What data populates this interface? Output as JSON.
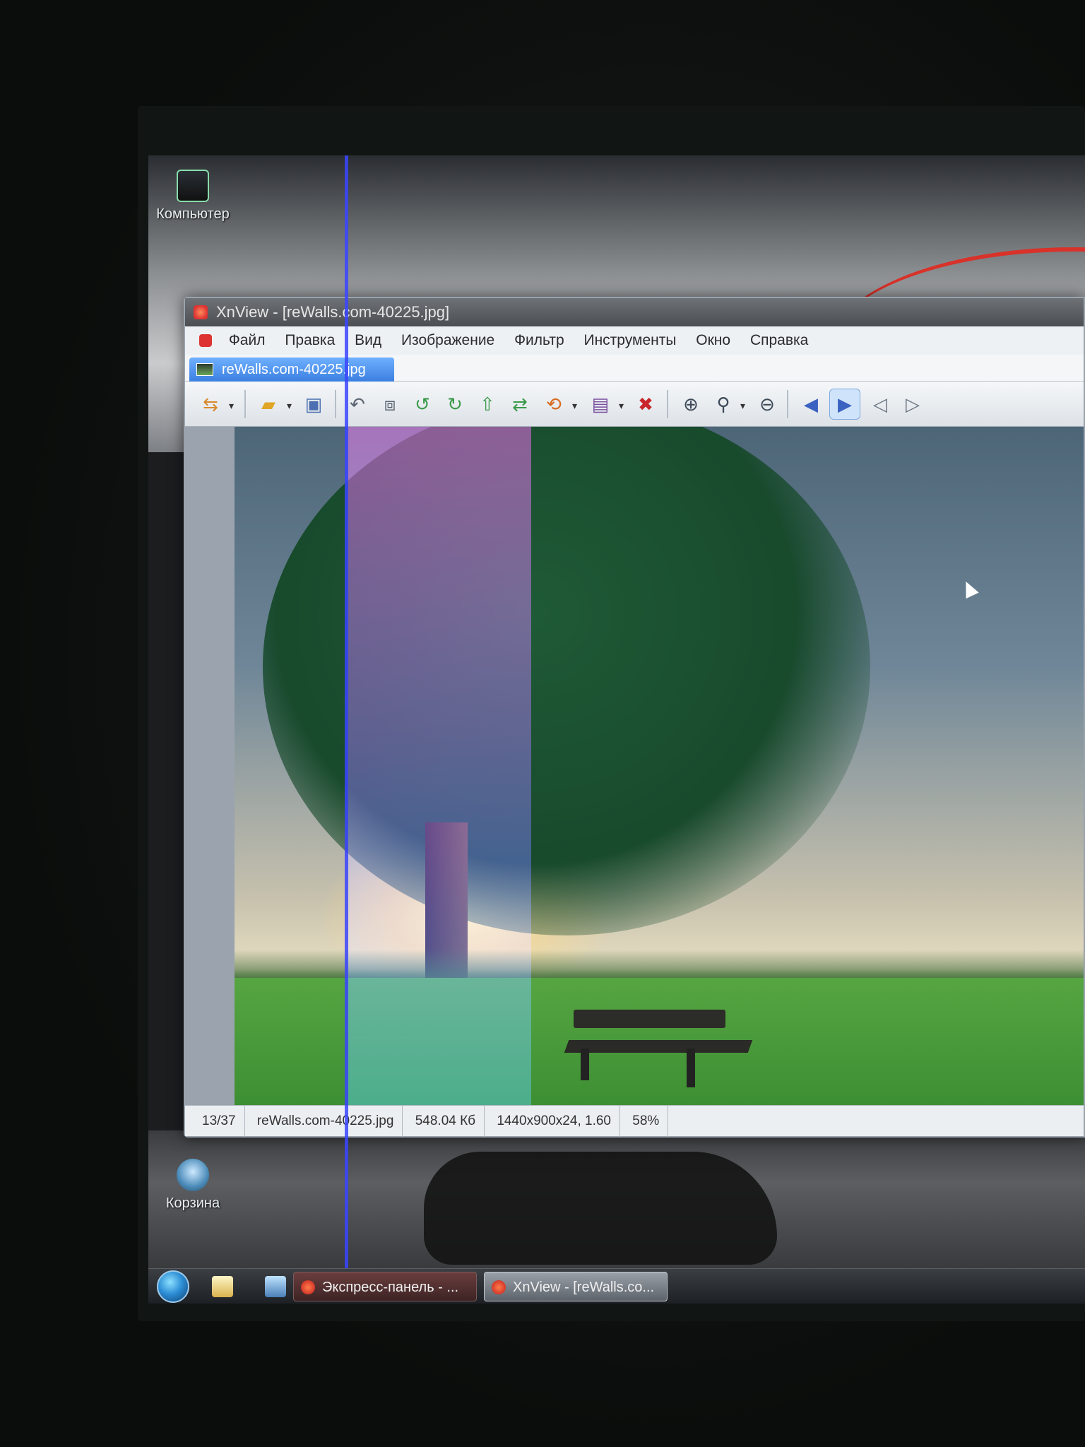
{
  "desktop": {
    "icon_computer_label": "Компьютер",
    "icon_trash_label": "Корзина"
  },
  "window": {
    "title": "XnView - [reWalls.com-40225.jpg]",
    "menu": [
      "Файл",
      "Правка",
      "Вид",
      "Изображение",
      "Фильтр",
      "Инструменты",
      "Окно",
      "Справка"
    ],
    "tab_label": "reWalls.com-40225.jpg",
    "toolbar_icons": [
      "browser-icon",
      "open-folder-icon",
      "save-icon",
      "undo-icon",
      "crop-icon",
      "rotate-left-icon",
      "rotate-right-icon",
      "export-icon",
      "convert-icon",
      "batch-icon",
      "slideshow-icon",
      "delete-icon",
      "zoom-in-icon",
      "zoom-fit-icon",
      "zoom-out-icon",
      "previous-arrow-icon",
      "next-arrow-icon",
      "first-page-icon",
      "last-page-icon"
    ],
    "status": {
      "index": "13/37",
      "filename": "reWalls.com-40225.jpg",
      "size": "548.04 Кб",
      "dimensions": "1440x900x24, 1.60",
      "zoom": "58%"
    }
  },
  "taskbar": {
    "items": [
      {
        "label": "Экспресс-панель - ..."
      },
      {
        "label": "XnView - [reWalls.co..."
      }
    ]
  },
  "colors": {
    "accent_tab": "#3b7fe0",
    "glitch_line": "#3a45ff"
  }
}
